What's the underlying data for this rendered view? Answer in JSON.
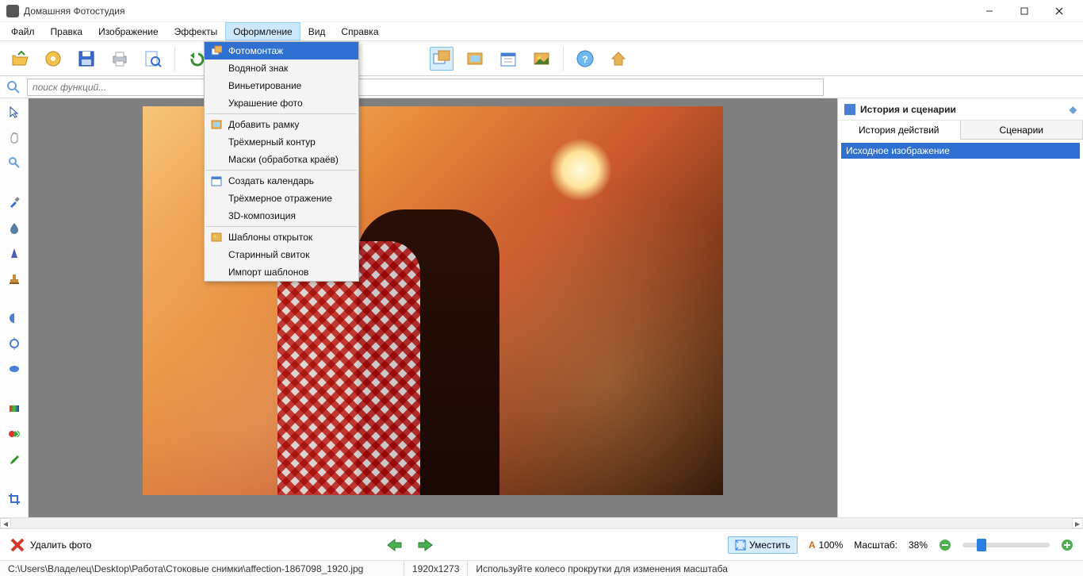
{
  "title": "Домашняя Фотостудия",
  "menu": [
    "Файл",
    "Правка",
    "Изображение",
    "Эффекты",
    "Оформление",
    "Вид",
    "Справка"
  ],
  "menu_open_index": 4,
  "dropdown": {
    "groups": [
      [
        "Фотомонтаж",
        "Водяной знак",
        "Виньетирование",
        "Украшение фото"
      ],
      [
        "Добавить рамку",
        "Трёхмерный контур",
        "Маски (обработка краёв)"
      ],
      [
        "Создать календарь",
        "Трёхмерное отражение",
        "3D-композиция"
      ],
      [
        "Шаблоны открыток",
        "Старинный свиток",
        "Импорт шаблонов"
      ]
    ],
    "highlight": "Фотомонтаж"
  },
  "search_placeholder": "поиск функций...",
  "right": {
    "title": "История и сценарии",
    "tabs": [
      "История действий",
      "Сценарии"
    ],
    "active_tab": 0,
    "items": [
      "Исходное изображение"
    ]
  },
  "bottom": {
    "delete": "Удалить фото",
    "fit": "Уместить",
    "zoom_actual": "100%",
    "scale_label": "Масштаб:",
    "scale_value": "38%"
  },
  "status": {
    "path": "C:\\Users\\Владелец\\Desktop\\Работа\\Стоковые снимки\\affection-1867098_1920.jpg",
    "dims": "1920x1273",
    "hint": "Используйте колесо прокрутки для изменения масштаба"
  }
}
